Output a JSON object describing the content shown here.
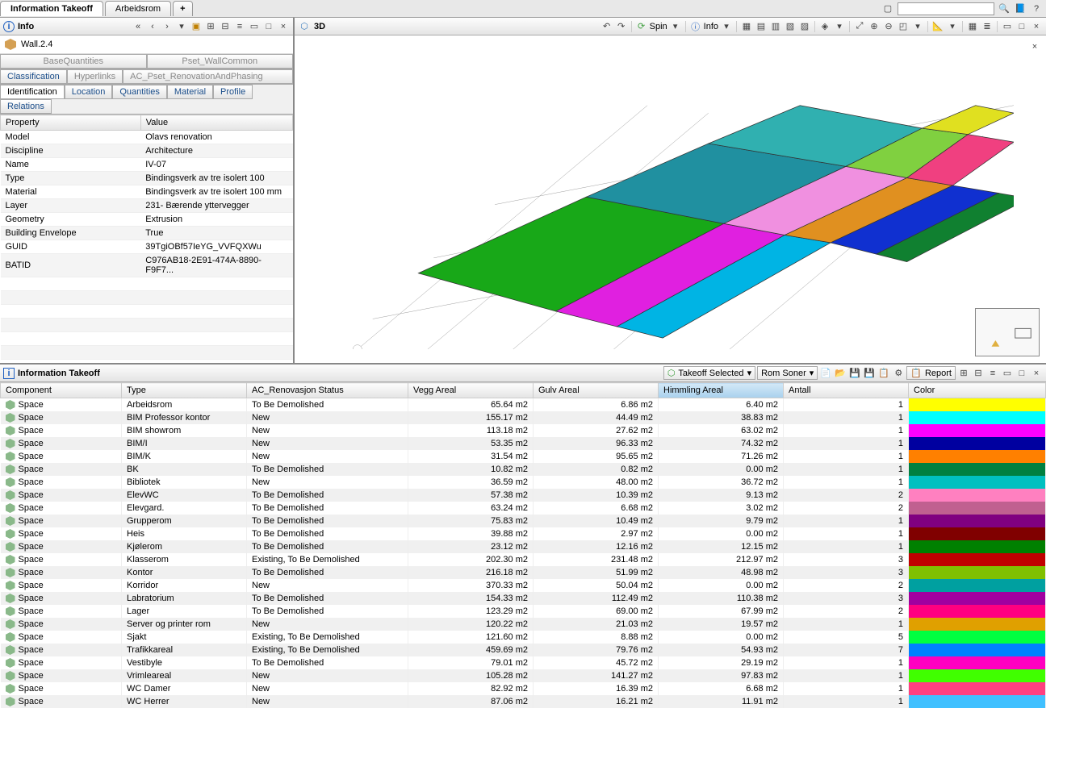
{
  "tabs": {
    "active": "Information Takeoff",
    "items": [
      "Information Takeoff",
      "Arbeidsrom"
    ]
  },
  "info_panel": {
    "title": "Info",
    "element": "Wall.2.4",
    "category_tabs_top": [
      "BaseQuantities",
      "Pset_WallCommon"
    ],
    "category_tabs_mid": [
      "Classification",
      "Hyperlinks",
      "AC_Pset_RenovationAndPhasing"
    ],
    "category_tabs_bottom": [
      "Identification",
      "Location",
      "Quantities",
      "Material",
      "Profile",
      "Relations"
    ],
    "active_tab": "Identification",
    "headers": [
      "Property",
      "Value"
    ],
    "rows": [
      {
        "k": "Model",
        "v": "Olavs renovation"
      },
      {
        "k": "Discipline",
        "v": "Architecture"
      },
      {
        "k": "Name",
        "v": "IV-07"
      },
      {
        "k": "Type",
        "v": "Bindingsverk av tre isolert 100"
      },
      {
        "k": "Material",
        "v": "Bindingsverk av tre isolert 100 mm"
      },
      {
        "k": "Layer",
        "v": "231- Bærende yttervegger"
      },
      {
        "k": "Geometry",
        "v": "Extrusion"
      },
      {
        "k": "Building Envelope",
        "v": "True"
      },
      {
        "k": "GUID",
        "v": "39TgiOBf57IeYG_VVFQXWu"
      },
      {
        "k": "BATID",
        "v": "C976AB18-2E91-474A-8890-F9F7..."
      }
    ]
  },
  "viewer": {
    "title": "3D",
    "tools": {
      "spin": "Spin",
      "info": "Info"
    }
  },
  "takeoff": {
    "title": "Information Takeoff",
    "dropdowns": {
      "selected": "Takeoff Selected",
      "group": "Rom Soner",
      "report": "Report"
    },
    "headers": [
      "Component",
      "Type",
      "AC_Renovasjon Status",
      "Vegg Areal",
      "Gulv Areal",
      "Himmling Areal",
      "Antall",
      "Color"
    ],
    "sorted_col": 5,
    "rows": [
      {
        "comp": "Space",
        "type": "Arbeidsrom",
        "status": "To Be Demolished",
        "vegg": "65.64 m2",
        "gulv": "6.86 m2",
        "him": "6.40 m2",
        "ant": "1",
        "color": "#ffff00"
      },
      {
        "comp": "Space",
        "type": "BIM Professor kontor",
        "status": "New",
        "vegg": "155.17 m2",
        "gulv": "44.49 m2",
        "him": "38.83 m2",
        "ant": "1",
        "color": "#00ffff"
      },
      {
        "comp": "Space",
        "type": "BIM showrom",
        "status": "New",
        "vegg": "113.18 m2",
        "gulv": "27.62 m2",
        "him": "63.02 m2",
        "ant": "1",
        "color": "#ff00ff"
      },
      {
        "comp": "Space",
        "type": "BIM/I",
        "status": "New",
        "vegg": "53.35 m2",
        "gulv": "96.33 m2",
        "him": "74.32 m2",
        "ant": "1",
        "color": "#0000a0"
      },
      {
        "comp": "Space",
        "type": "BIM/K",
        "status": "New",
        "vegg": "31.54 m2",
        "gulv": "95.65 m2",
        "him": "71.26 m2",
        "ant": "1",
        "color": "#ff8000"
      },
      {
        "comp": "Space",
        "type": "BK",
        "status": "To Be Demolished",
        "vegg": "10.82 m2",
        "gulv": "0.82 m2",
        "him": "0.00 m2",
        "ant": "1",
        "color": "#008040"
      },
      {
        "comp": "Space",
        "type": "Bibliotek",
        "status": "New",
        "vegg": "36.59 m2",
        "gulv": "48.00 m2",
        "him": "36.72 m2",
        "ant": "1",
        "color": "#00c0c0"
      },
      {
        "comp": "Space",
        "type": "ElevWC",
        "status": "To Be Demolished",
        "vegg": "57.38 m2",
        "gulv": "10.39 m2",
        "him": "9.13 m2",
        "ant": "2",
        "color": "#ff80c0"
      },
      {
        "comp": "Space",
        "type": "Elevgard.",
        "status": "To Be Demolished",
        "vegg": "63.24 m2",
        "gulv": "6.68 m2",
        "him": "3.02 m2",
        "ant": "2",
        "color": "#c06090"
      },
      {
        "comp": "Space",
        "type": "Grupperom",
        "status": "To Be Demolished",
        "vegg": "75.83 m2",
        "gulv": "10.49 m2",
        "him": "9.79 m2",
        "ant": "1",
        "color": "#800080"
      },
      {
        "comp": "Space",
        "type": "Heis",
        "status": "To Be Demolished",
        "vegg": "39.88 m2",
        "gulv": "2.97 m2",
        "him": "0.00 m2",
        "ant": "1",
        "color": "#800000"
      },
      {
        "comp": "Space",
        "type": "Kjølerom",
        "status": "To Be Demolished",
        "vegg": "23.12 m2",
        "gulv": "12.16 m2",
        "him": "12.15 m2",
        "ant": "1",
        "color": "#008000"
      },
      {
        "comp": "Space",
        "type": "Klasserom",
        "status": "Existing, To Be Demolished",
        "vegg": "202.30 m2",
        "gulv": "231.48 m2",
        "him": "212.97 m2",
        "ant": "3",
        "color": "#c00000"
      },
      {
        "comp": "Space",
        "type": "Kontor",
        "status": "To Be Demolished",
        "vegg": "216.18 m2",
        "gulv": "51.99 m2",
        "him": "48.98 m2",
        "ant": "3",
        "color": "#80c000"
      },
      {
        "comp": "Space",
        "type": "Korridor",
        "status": "New",
        "vegg": "370.33 m2",
        "gulv": "50.04 m2",
        "him": "0.00 m2",
        "ant": "2",
        "color": "#00a0a0"
      },
      {
        "comp": "Space",
        "type": "Labratorium",
        "status": "To Be Demolished",
        "vegg": "154.33 m2",
        "gulv": "112.49 m2",
        "him": "110.38 m2",
        "ant": "3",
        "color": "#a000a0"
      },
      {
        "comp": "Space",
        "type": "Lager",
        "status": "To Be Demolished",
        "vegg": "123.29 m2",
        "gulv": "69.00 m2",
        "him": "67.99 m2",
        "ant": "2",
        "color": "#ff0080"
      },
      {
        "comp": "Space",
        "type": "Server og printer rom",
        "status": "New",
        "vegg": "120.22 m2",
        "gulv": "21.03 m2",
        "him": "19.57 m2",
        "ant": "1",
        "color": "#e0a000"
      },
      {
        "comp": "Space",
        "type": "Sjakt",
        "status": "Existing, To Be Demolished",
        "vegg": "121.60 m2",
        "gulv": "8.88 m2",
        "him": "0.00 m2",
        "ant": "5",
        "color": "#00ff40"
      },
      {
        "comp": "Space",
        "type": "Trafikkareal",
        "status": "Existing, To Be Demolished",
        "vegg": "459.69 m2",
        "gulv": "79.76 m2",
        "him": "54.93 m2",
        "ant": "7",
        "color": "#0080ff"
      },
      {
        "comp": "Space",
        "type": "Vestibyle",
        "status": "To Be Demolished",
        "vegg": "79.01 m2",
        "gulv": "45.72 m2",
        "him": "29.19 m2",
        "ant": "1",
        "color": "#ff00c0"
      },
      {
        "comp": "Space",
        "type": "Vrimleareal",
        "status": "New",
        "vegg": "105.28 m2",
        "gulv": "141.27 m2",
        "him": "97.83 m2",
        "ant": "1",
        "color": "#40ff00"
      },
      {
        "comp": "Space",
        "type": "WC Damer",
        "status": "New",
        "vegg": "82.92 m2",
        "gulv": "16.39 m2",
        "him": "6.68 m2",
        "ant": "1",
        "color": "#ff4080"
      },
      {
        "comp": "Space",
        "type": "WC Herrer",
        "status": "New",
        "vegg": "87.06 m2",
        "gulv": "16.21 m2",
        "him": "11.91 m2",
        "ant": "1",
        "color": "#40c0ff"
      }
    ]
  }
}
